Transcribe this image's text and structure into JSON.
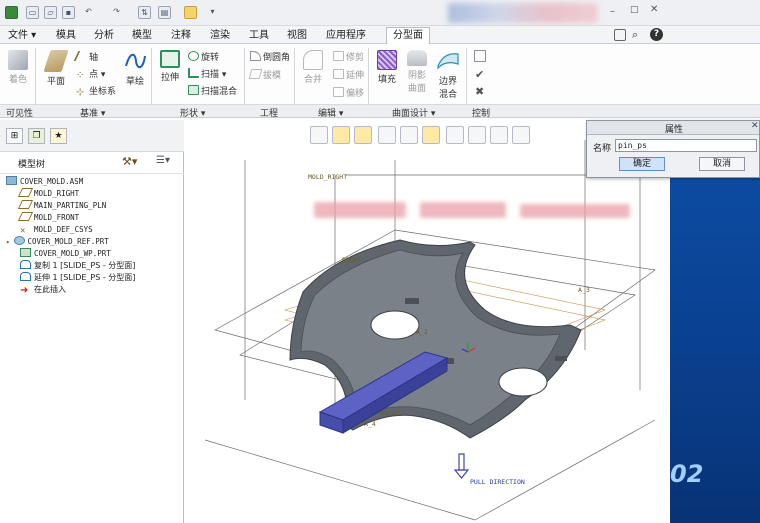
{
  "menubar": {
    "file": "文件",
    "tabs": [
      "模具",
      "分析",
      "模型",
      "注释",
      "渲染",
      "工具",
      "视图",
      "应用程序",
      "分型面"
    ]
  },
  "ribbon": {
    "visibility": {
      "label": "着色"
    },
    "datum": {
      "plane": "平面",
      "axis": "轴",
      "point": "点",
      "csys": "坐标系",
      "sketch": "草绘"
    },
    "shapes": {
      "extrude": "拉伸",
      "revolve": "旋转",
      "sweep": "扫描",
      "swept_blend": "扫描混合"
    },
    "engineering": {
      "round": "倒圆角",
      "draft": "拔模"
    },
    "editing": {
      "merge": "合并",
      "trim": "修剪",
      "extend": "延伸",
      "offset": "偏移"
    },
    "surface_design": {
      "fill": "填充",
      "shade_surface": "曲面",
      "boundary_blend": "边界混合",
      "shade_top": "阴影",
      "boundary_top": "边界",
      "blend_bottom": "混合"
    },
    "control": {}
  },
  "groups": [
    "可见性",
    "基准",
    "形状",
    "工程",
    "编辑",
    "曲面设计",
    "控制"
  ],
  "panel": {
    "title": "模型树"
  },
  "tree": [
    {
      "label": "COVER_MOLD.ASM",
      "icon": "assembly-icon"
    },
    {
      "label": "MOLD_RIGHT",
      "icon": "datum-plane-icon"
    },
    {
      "label": "MAIN_PARTING_PLN",
      "icon": "datum-plane-icon"
    },
    {
      "label": "MOLD_FRONT",
      "icon": "datum-plane-icon"
    },
    {
      "label": "MOLD_DEF_CSYS",
      "icon": "csys-icon"
    },
    {
      "label": "COVER_MOLD_REF.PRT",
      "icon": "part-icon"
    },
    {
      "label": "COVER_MOLD_WP.PRT",
      "icon": "workpiece-icon"
    },
    {
      "label": "复制 1 [SLIDE_PS - 分型面]",
      "icon": "copy-surface-icon"
    },
    {
      "label": "延伸 1 [SLIDE_PS - 分型面]",
      "icon": "extend-surface-icon"
    },
    {
      "label": "在此插入",
      "icon": "insert-here-arrow-icon"
    }
  ],
  "viewport": {
    "labels": {
      "mold_right": "MOLD_RIGHT",
      "right": "RIGHT",
      "front": "FRONT",
      "pull": "PULL DIRECTION",
      "a3": "A_3",
      "a2": "A_2",
      "a4": "A_4"
    }
  },
  "dialog": {
    "title": "属性",
    "name_label": "名称",
    "name_value": "pin_ps",
    "ok": "确定",
    "cancel": "取消"
  },
  "overlay_text": "02",
  "colors": {
    "ribbon_bg": "#fdfdfd",
    "panel_blue": "#0a3f8e",
    "model_grey": "#5f666d",
    "surface_blue": "#5c63c4"
  }
}
